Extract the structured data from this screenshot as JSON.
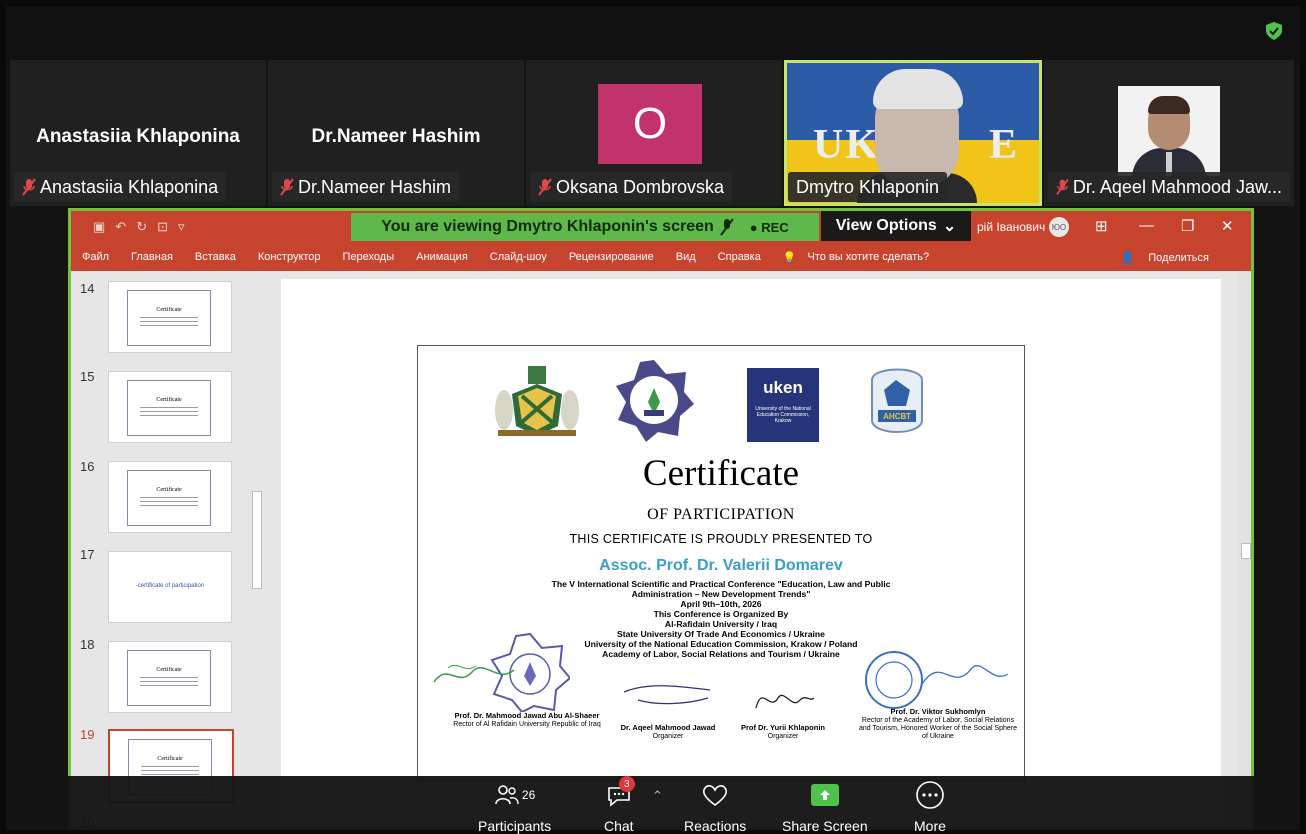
{
  "participants_strip": [
    {
      "big_name": "Anastasiia Khlaponina",
      "label": "Anastasiia Khlaponina"
    },
    {
      "big_name": "Dr.Nameer Hashim",
      "label": "Dr.Nameer Hashim"
    },
    {
      "avatar_letter": "O",
      "label": "Oksana Dombrovska"
    },
    {
      "label": "Dmytro Khlaponin",
      "video_text_left": "UK",
      "video_text_right": "E"
    },
    {
      "label": "Dr. Aqeel Mahmood Jaw..."
    }
  ],
  "share_banner": {
    "viewing": "You are viewing  Dmytro Khlaponin's screen",
    "rec": "REC",
    "view_options": "View Options"
  },
  "ppt": {
    "user": "рій Іванович",
    "avatar": "ЮО",
    "ribbon": [
      "Файл",
      "Главная",
      "Вставка",
      "Конструктор",
      "Переходы",
      "Анимация",
      "Слайд-шоу",
      "Рецензирование",
      "Вид",
      "Справка"
    ],
    "tell_me": "Что вы хотите сделать?",
    "share": "Поделиться",
    "slides": [
      {
        "num": "14",
        "kind": "cert",
        "title": "Certificate"
      },
      {
        "num": "15",
        "kind": "cert",
        "title": "Certificate"
      },
      {
        "num": "16",
        "kind": "cert",
        "title": "Certificate"
      },
      {
        "num": "17",
        "kind": "text",
        "text": "-certificate of participation"
      },
      {
        "num": "18",
        "kind": "cert",
        "title": "Certificate"
      },
      {
        "num": "19",
        "kind": "cert",
        "title": "Certificate",
        "selected": true
      },
      {
        "num": "20",
        "kind": "partial"
      }
    ]
  },
  "certificate": {
    "uken_logo": "uken",
    "uken_sub": "University of the National Education Commission, Krakow",
    "ansbt_logo": "АНСВТ",
    "title": "Certificate",
    "subtitle": "OF PARTICIPATION",
    "presented": "THIS CERTIFICATE IS PROUDLY PRESENTED TO",
    "recipient": "Assoc. Prof. Dr. Valerii Domarev",
    "body": [
      "The V International Scientific and Practical Conference \"Education, Law and Public",
      "Administration – New Development Trends\"",
      "April 9th–10th, 2026",
      "This Conference is Organized By",
      "Al-Rafidain University / Iraq",
      "State University Of Trade And Economics / Ukraine",
      "University of the National Education Commission, Krakow / Poland",
      "Academy of Labor, Social Relations and Tourism / Ukraine"
    ],
    "signatures": [
      {
        "name": "Prof. Dr. Mahmood Jawad Abu Al-Shaeer",
        "role": "Rector of Al Rafidain University Republic of Iraq"
      },
      {
        "name": "Dr. Aqeel Mahmood Jawad",
        "role": "Organizer"
      },
      {
        "name": "Prof Dr. Yurii Khlaponin",
        "role": "Organizer"
      },
      {
        "name": "Prof. Dr. Viktor Sukhomlyn",
        "role": "Rector of the Academy of Labor, Social Relations and Tourism, Honored Worker of the Social Sphere of Ukraine"
      }
    ]
  },
  "toolbar": {
    "participants_label": "Participants",
    "participants_count": "26",
    "chat_label": "Chat",
    "chat_badge": "3",
    "reactions_label": "Reactions",
    "share_label": "Share Screen",
    "more_label": "More"
  },
  "colors": {
    "active_speaker": "#c9e46a",
    "share_border": "#72c33a",
    "ppt_accent": "#c6442d",
    "recipient": "#3b9ec7",
    "share_screen": "#4ec24a"
  }
}
